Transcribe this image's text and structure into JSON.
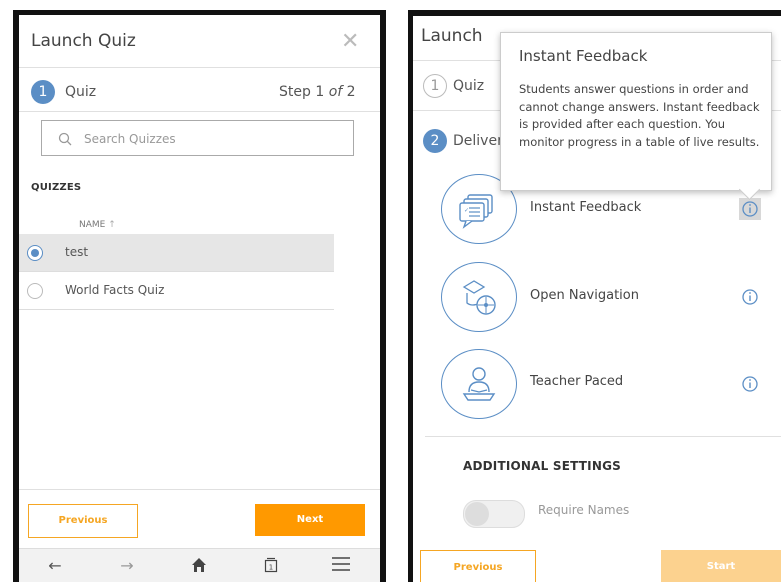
{
  "left": {
    "title": "Launch Quiz",
    "step_number": "1",
    "step_label": "Quiz",
    "step_counter_prefix": "Step 1 ",
    "step_counter_of": "of",
    "step_counter_total": " 2",
    "search_placeholder": "Search Quizzes",
    "quizzes_heading": "QUIZZES",
    "name_column": "NAME",
    "quizzes": [
      {
        "label": "test",
        "selected": true
      },
      {
        "label": "World Facts Quiz",
        "selected": false
      }
    ],
    "previous_label": "Previous",
    "next_label": "Next",
    "nav_icons": [
      "back-arrow-icon",
      "forward-arrow-icon",
      "home-icon",
      "tabs-icon",
      "menu-icon"
    ],
    "tab_count": "1"
  },
  "right": {
    "title": "Launch",
    "step1_number": "1",
    "step1_label": "Quiz",
    "step2_number": "2",
    "step2_label": "Delivery",
    "tooltip": {
      "title": "Instant Feedback",
      "body": "Students answer questions in order and cannot change answers. Instant feedback is provided after each question. You monitor progress in a table of live results."
    },
    "delivery_options": [
      {
        "label": "Instant Feedback",
        "icon": "chat-bubbles-icon"
      },
      {
        "label": "Open Navigation",
        "icon": "compass-icon"
      },
      {
        "label": "Teacher Paced",
        "icon": "teacher-icon"
      }
    ],
    "additional_settings_heading": "ADDITIONAL SETTINGS",
    "require_names_label": "Require Names",
    "previous_label": "Previous",
    "start_label": "Start"
  },
  "colors": {
    "accent_blue": "#5b8ec5",
    "orange": "#ff9900",
    "pale_orange": "#fcd28f"
  }
}
